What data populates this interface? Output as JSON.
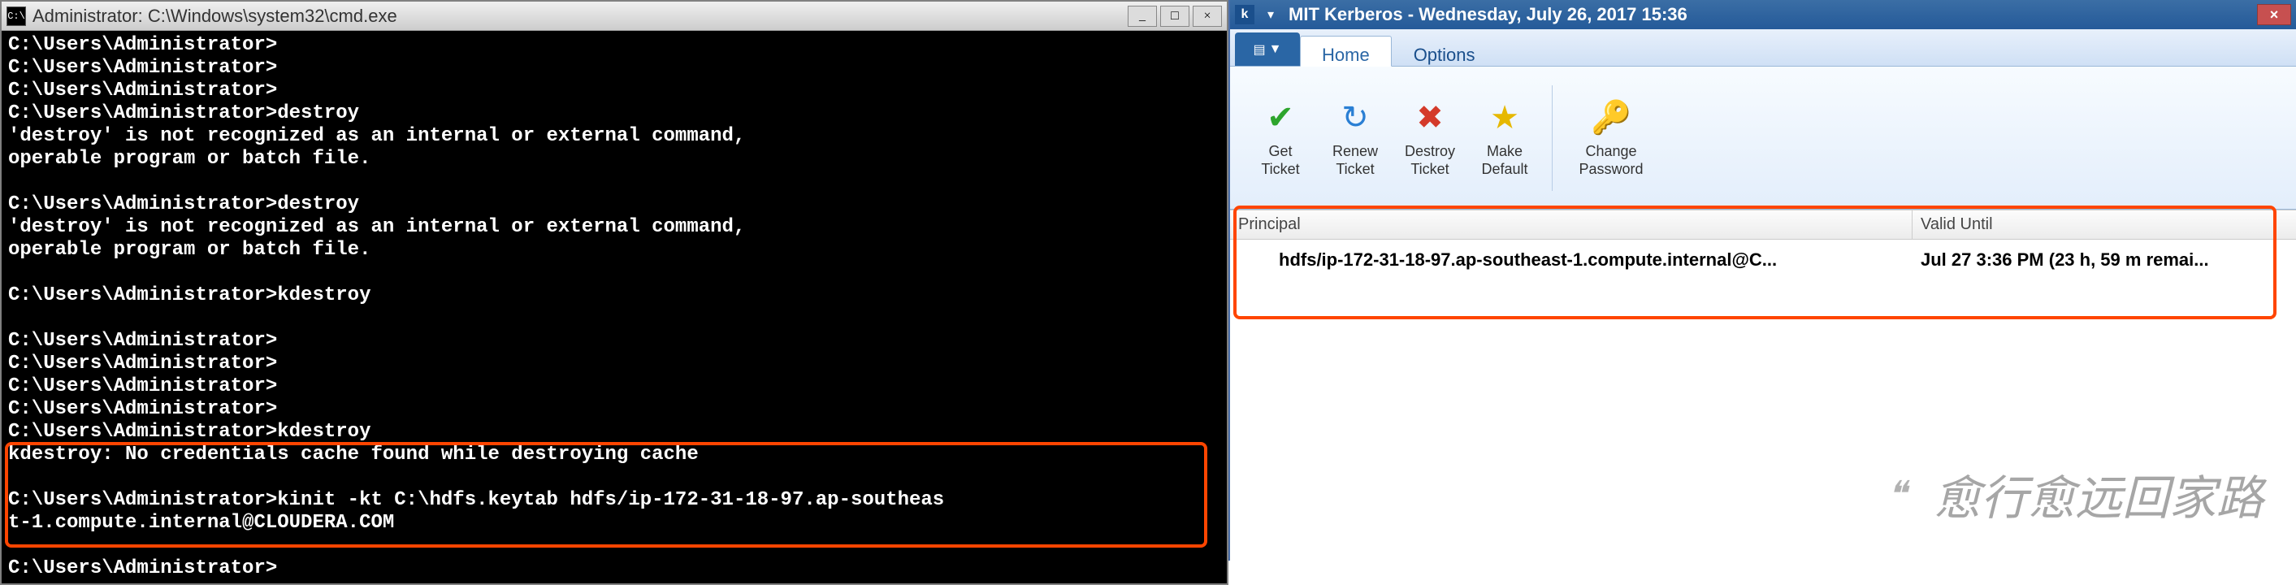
{
  "cmd": {
    "title": "Administrator: C:\\Windows\\system32\\cmd.exe",
    "lines": [
      "C:\\Users\\Administrator>",
      "C:\\Users\\Administrator>",
      "C:\\Users\\Administrator>",
      "C:\\Users\\Administrator>destroy",
      "'destroy' is not recognized as an internal or external command,",
      "operable program or batch file.",
      "",
      "C:\\Users\\Administrator>destroy",
      "'destroy' is not recognized as an internal or external command,",
      "operable program or batch file.",
      "",
      "C:\\Users\\Administrator>kdestroy",
      "",
      "C:\\Users\\Administrator>",
      "C:\\Users\\Administrator>",
      "C:\\Users\\Administrator>",
      "C:\\Users\\Administrator>",
      "C:\\Users\\Administrator>kdestroy",
      "kdestroy: No credentials cache found while destroying cache",
      "",
      "C:\\Users\\Administrator>kinit -kt C:\\hdfs.keytab hdfs/ip-172-31-18-97.ap-southeas",
      "t-1.compute.internal@CLOUDERA.COM",
      "",
      "C:\\Users\\Administrator>"
    ],
    "controls": {
      "min": "_",
      "max": "□",
      "close": "×"
    }
  },
  "kerb": {
    "title": "MIT Kerberos -  Wednesday, July 26, 2017  15:36",
    "close": "×",
    "tabs": {
      "home": "Home",
      "options": "Options"
    },
    "ribbon": {
      "get_ticket": "Get Ticket",
      "renew_ticket": "Renew Ticket",
      "destroy_ticket": "Destroy Ticket",
      "make_default": "Make Default",
      "change_password": "Change Password"
    },
    "columns": {
      "principal": "Principal",
      "valid_until": "Valid Until"
    },
    "row": {
      "principal": "hdfs/ip-172-31-18-97.ap-southeast-1.compute.internal@C...",
      "valid": "Jul 27  3:36 PM (23 h, 59 m remai..."
    }
  },
  "watermark": "愈行愈远回家路"
}
